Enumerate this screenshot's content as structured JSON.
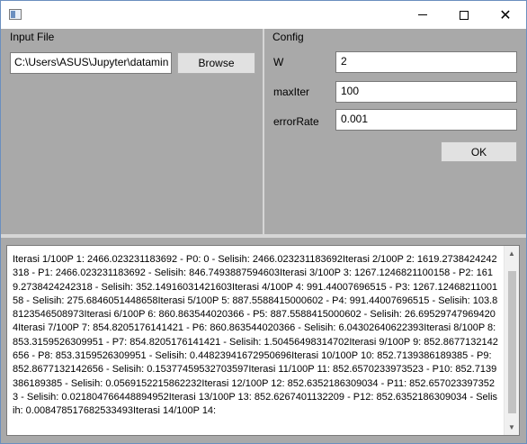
{
  "window": {
    "title": "",
    "icons": {
      "app": "app-window-icon",
      "minimize": "minimize-icon",
      "maximize": "maximize-icon",
      "close": "close-icon"
    },
    "close_glyph": "✕"
  },
  "input_file": {
    "group_label": "Input File",
    "path_value": "C:\\Users\\ASUS\\Jupyter\\datamin",
    "browse_label": "Browse"
  },
  "config": {
    "group_label": "Config",
    "w_label": "W",
    "w_value": "2",
    "maxiter_label": "maxIter",
    "maxiter_value": "100",
    "errorrate_label": "errorRate",
    "errorrate_value": "0.001",
    "ok_label": "OK"
  },
  "log": {
    "text": "Iterasi 1/100P 1: 2466.023231183692 - P0: 0 - Selisih: 2466.023231183692Iterasi 2/100P 2: 1619.2738424242318 - P1: 2466.023231183692 - Selisih: 846.7493887594603Iterasi 3/100P 3: 1267.1246821100158 - P2: 1619.2738424242318 - Selisih: 352.14916031421603Iterasi 4/100P 4: 991.44007696515 - P3: 1267.1246821100158 - Selisih: 275.6846051448658Iterasi 5/100P 5: 887.5588415000602 - P4: 991.44007696515 - Selisih: 103.88123546508973Iterasi 6/100P 6: 860.863544020366 - P5: 887.5588415000602 - Selisih: 26.695297479694204Iterasi 7/100P 7: 854.8205176141421 - P6: 860.863544020366 - Selisih: 6.04302640622393Iterasi 8/100P 8: 853.3159526309951 - P7: 854.8205176141421 - Selisih: 1.50456498314702Iterasi 9/100P 9: 852.8677132142656 - P8: 853.3159526309951 - Selisih: 0.44823941672950696Iterasi 10/100P 10: 852.7139386189385 - P9: 852.8677132142656 - Selisih: 0.15377459532703597Iterasi 11/100P 11: 852.6570233973523 - P10: 852.7139386189385 - Selisih: 0.0569152215862232Iterasi 12/100P 12: 852.6352186309034 - P11: 852.6570233973523 - Selisih: 0.021804766448894952Iterasi 13/100P 13: 852.6267401132209 - P12: 852.6352186309034 - Selisih: 0.008478517682533493Iterasi 14/100P 14:",
    "scroll_up_glyph": "▲",
    "scroll_down_glyph": "▼"
  }
}
